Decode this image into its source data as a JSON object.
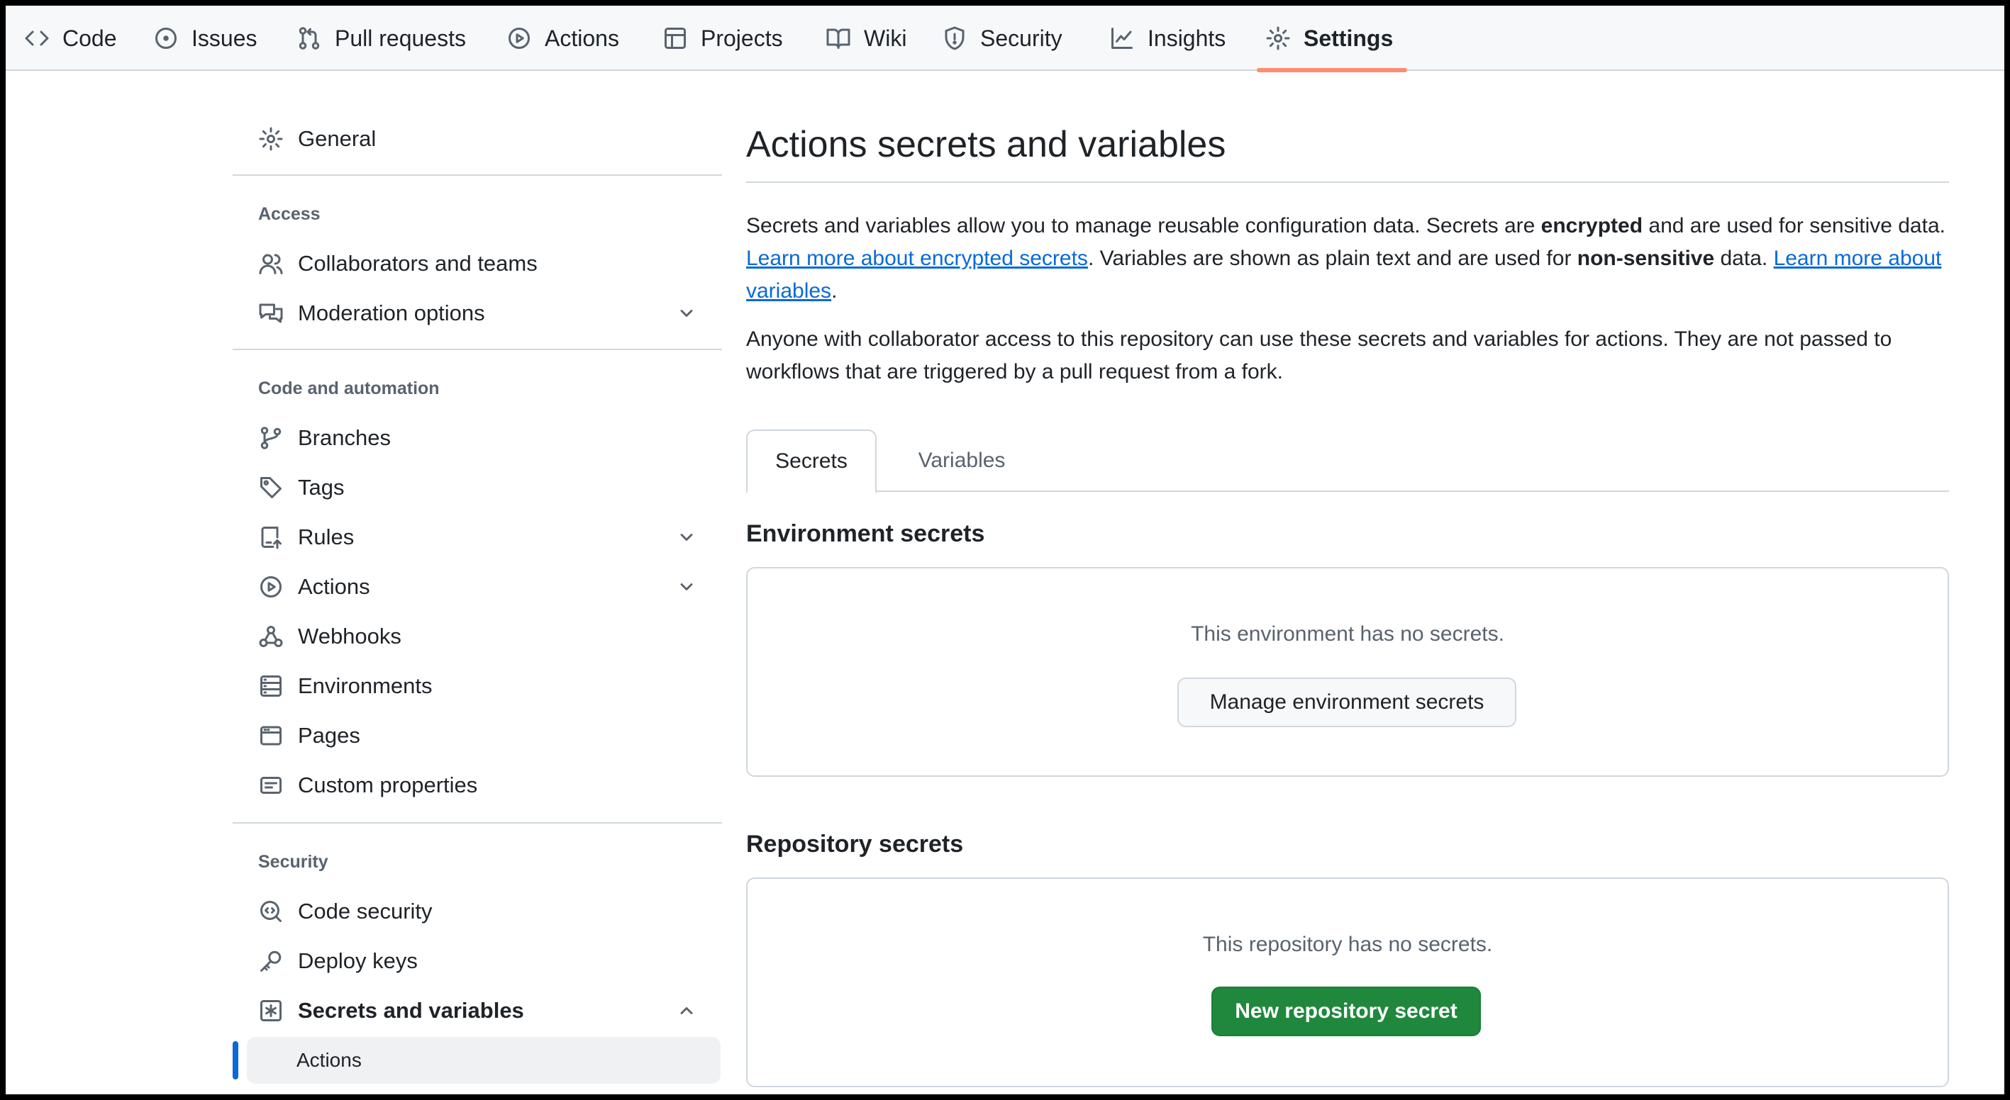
{
  "topnav": {
    "tabs": [
      {
        "label": "Code",
        "icon": "code-icon"
      },
      {
        "label": "Issues",
        "icon": "issue-opened-icon"
      },
      {
        "label": "Pull requests",
        "icon": "git-pull-request-icon"
      },
      {
        "label": "Actions",
        "icon": "play-icon"
      },
      {
        "label": "Projects",
        "icon": "table-icon"
      },
      {
        "label": "Wiki",
        "icon": "book-icon"
      },
      {
        "label": "Security",
        "icon": "shield-icon"
      },
      {
        "label": "Insights",
        "icon": "graph-icon"
      },
      {
        "label": "Settings",
        "icon": "gear-icon",
        "active": true
      }
    ],
    "active_underline_color": "#fd8c73"
  },
  "sidebar": {
    "general": "General",
    "access_heading": "Access",
    "collaborators": "Collaborators and teams",
    "moderation": "Moderation options",
    "code_heading": "Code and automation",
    "branches": "Branches",
    "tags": "Tags",
    "rules": "Rules",
    "actions": "Actions",
    "webhooks": "Webhooks",
    "environments": "Environments",
    "pages": "Pages",
    "custom_properties": "Custom properties",
    "security_heading": "Security",
    "code_security": "Code security",
    "deploy_keys": "Deploy keys",
    "secrets_variables": "Secrets and variables",
    "sub_actions": "Actions",
    "selected_indicator_color": "#0969da"
  },
  "main": {
    "title": "Actions secrets and variables",
    "desc": {
      "part1": "Secrets and variables allow you to manage reusable configuration data. Secrets are ",
      "bold1": "encrypted",
      "part2": " and are used for sensitive data. ",
      "link1": "Learn more about encrypted secrets",
      "part3": ". Variables are shown as plain text and are used for ",
      "bold2": "non-sensitive",
      "part4": " data. ",
      "link2": "Learn more about variables",
      "part5": "."
    },
    "note": "Anyone with collaborator access to this repository can use these secrets and variables for actions. They are not passed to workflows that are triggered by a pull request from a fork.",
    "tabs": {
      "secrets": "Secrets",
      "variables": "Variables"
    },
    "env_section": {
      "title": "Environment secrets",
      "empty": "This environment has no secrets.",
      "button": "Manage environment secrets"
    },
    "repo_section": {
      "title": "Repository secrets",
      "empty": "This repository has no secrets.",
      "button": "New repository secret"
    },
    "primary_button_color": "#1f883d",
    "link_color": "#0969da"
  }
}
